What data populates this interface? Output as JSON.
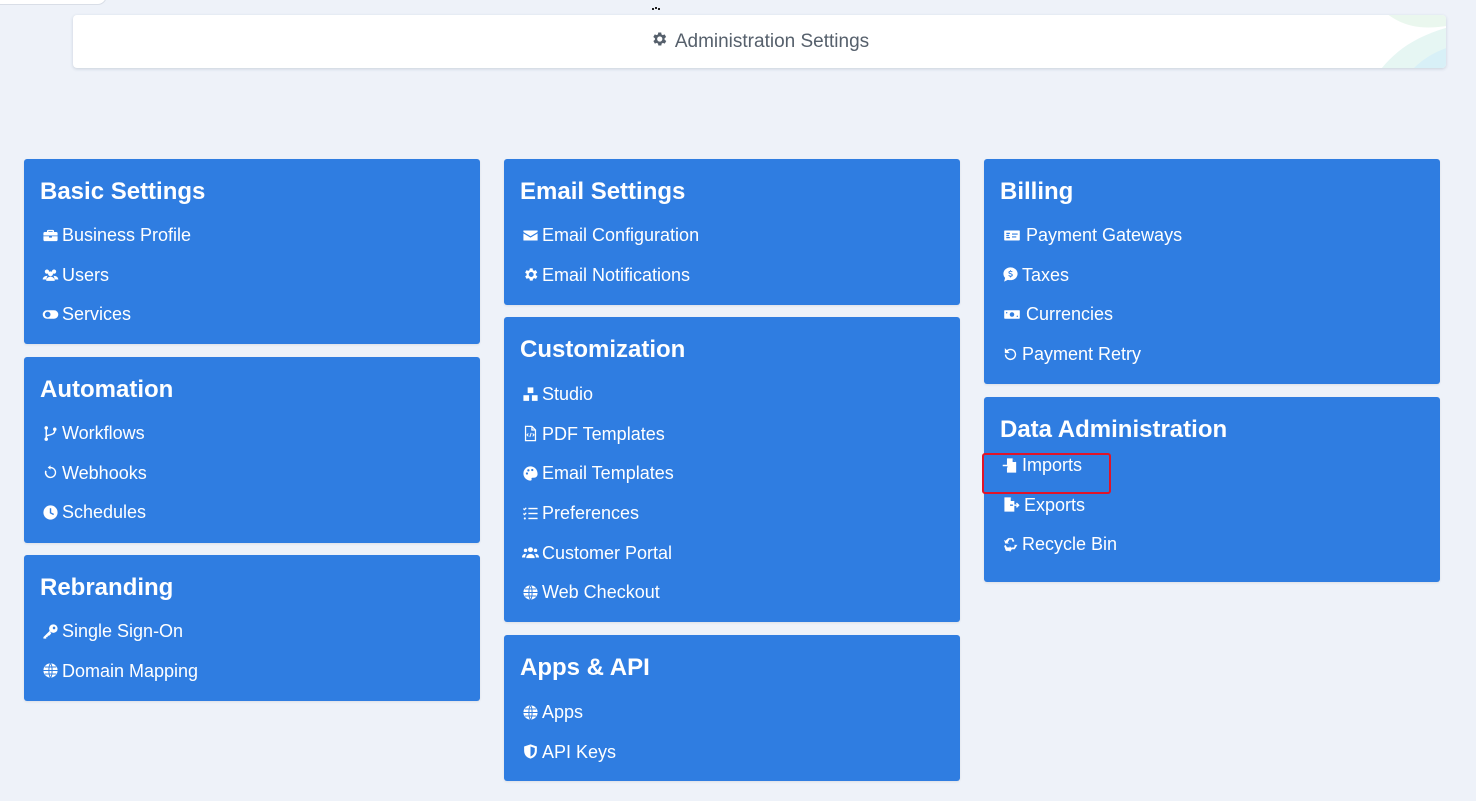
{
  "header": {
    "title": "Administration Settings",
    "icon": "gear-icon"
  },
  "cards": {
    "basic": {
      "title": "Basic Settings",
      "items": [
        {
          "label": "Business Profile",
          "icon": "briefcase-icon"
        },
        {
          "label": "Users",
          "icon": "users-icon"
        },
        {
          "label": "Services",
          "icon": "toggle-icon"
        }
      ]
    },
    "automation": {
      "title": "Automation",
      "items": [
        {
          "label": "Workflows",
          "icon": "code-branch-icon"
        },
        {
          "label": "Webhooks",
          "icon": "refresh-icon"
        },
        {
          "label": "Schedules",
          "icon": "clock-icon"
        }
      ]
    },
    "rebranding": {
      "title": "Rebranding",
      "items": [
        {
          "label": "Single Sign-On",
          "icon": "key-icon"
        },
        {
          "label": "Domain Mapping",
          "icon": "globe-icon"
        }
      ]
    },
    "email": {
      "title": "Email Settings",
      "items": [
        {
          "label": "Email Configuration",
          "icon": "envelope-icon"
        },
        {
          "label": "Email Notifications",
          "icon": "gear-icon"
        }
      ]
    },
    "customization": {
      "title": "Customization",
      "items": [
        {
          "label": "Studio",
          "icon": "cubes-icon"
        },
        {
          "label": "PDF Templates",
          "icon": "file-code-icon"
        },
        {
          "label": "Email Templates",
          "icon": "palette-icon"
        },
        {
          "label": "Preferences",
          "icon": "list-check-icon"
        },
        {
          "label": "Customer Portal",
          "icon": "users-icon"
        },
        {
          "label": "Web Checkout",
          "icon": "globe-icon"
        }
      ]
    },
    "apps": {
      "title": "Apps & API",
      "items": [
        {
          "label": "Apps",
          "icon": "globe-icon"
        },
        {
          "label": "API Keys",
          "icon": "shield-icon"
        }
      ]
    },
    "billing": {
      "title": "Billing",
      "items": [
        {
          "label": "Payment Gateways",
          "icon": "money-check-icon"
        },
        {
          "label": "Taxes",
          "icon": "dollar-comment-icon"
        },
        {
          "label": "Currencies",
          "icon": "money-bill-icon"
        },
        {
          "label": "Payment Retry",
          "icon": "rotate-left-icon"
        }
      ]
    },
    "data": {
      "title": "Data Administration",
      "items": [
        {
          "label": "Imports",
          "icon": "file-import-icon"
        },
        {
          "label": "Exports",
          "icon": "file-export-icon"
        },
        {
          "label": "Recycle Bin",
          "icon": "recycle-icon"
        }
      ]
    }
  },
  "colors": {
    "card": "#2f7de1",
    "background": "#eef2f9",
    "highlight": "#e0142a",
    "header_text": "#56606c"
  }
}
